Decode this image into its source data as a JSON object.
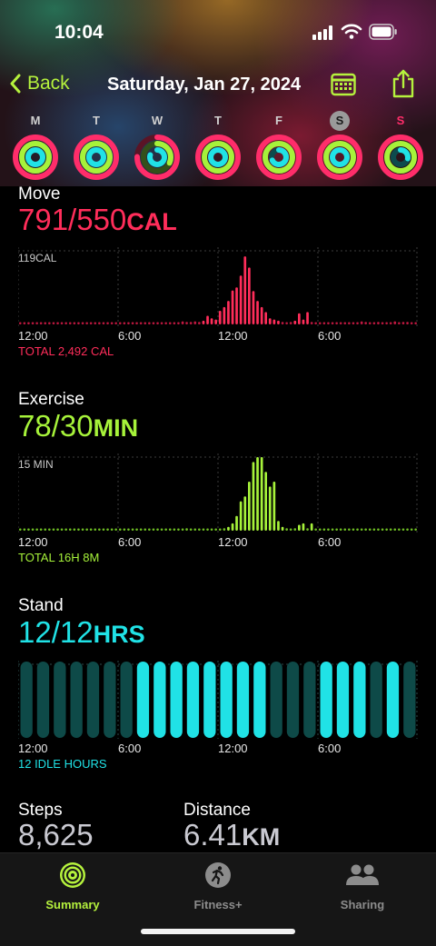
{
  "status": {
    "time": "10:04"
  },
  "nav": {
    "back_label": "Back",
    "title": "Saturday, Jan 27, 2024"
  },
  "week": [
    {
      "letter": "M"
    },
    {
      "letter": "T"
    },
    {
      "letter": "W"
    },
    {
      "letter": "T"
    },
    {
      "letter": "F"
    },
    {
      "letter": "S"
    },
    {
      "letter": "S"
    }
  ],
  "colors": {
    "move": "#ff2d5a",
    "exercise": "#a6f23a",
    "stand": "#20e2e6",
    "accent": "#b5f23d"
  },
  "move": {
    "title": "Move",
    "value": "791/550",
    "unit": "CAL",
    "max_label": "119CAL",
    "total": "TOTAL 2,492 CAL",
    "ticks": [
      "12:00",
      "6:00",
      "12:00",
      "6:00"
    ]
  },
  "exercise": {
    "title": "Exercise",
    "value": "78/30",
    "unit": "MIN",
    "max_label": "15 MIN",
    "total": "TOTAL 16H 8M",
    "ticks": [
      "12:00",
      "6:00",
      "12:00",
      "6:00"
    ]
  },
  "stand": {
    "title": "Stand",
    "value": "12/12",
    "unit": "HRS",
    "total": "12 IDLE HOURS",
    "ticks": [
      "12:00",
      "6:00",
      "12:00",
      "6:00"
    ]
  },
  "steps": {
    "label": "Steps",
    "value": "8,625"
  },
  "distance": {
    "label": "Distance",
    "value": "6.41",
    "unit": "KM"
  },
  "tabs": [
    {
      "label": "Summary",
      "icon": "activity-rings-icon"
    },
    {
      "label": "Fitness+",
      "icon": "fitness-runner-icon"
    },
    {
      "label": "Sharing",
      "icon": "people-icon"
    }
  ],
  "chart_data": [
    {
      "type": "bar",
      "title": "Move",
      "x": "minutes of day (2 bars per 15 min)",
      "ymax": 119,
      "values": [
        2,
        2,
        2,
        2,
        2,
        2,
        2,
        2,
        2,
        2,
        2,
        2,
        2,
        2,
        2,
        2,
        2,
        2,
        2,
        2,
        2,
        2,
        2,
        2,
        2,
        2,
        2,
        2,
        2,
        2,
        2,
        2,
        2,
        2,
        2,
        2,
        3,
        3,
        3,
        5,
        4,
        4,
        5,
        4,
        6,
        14,
        10,
        8,
        22,
        28,
        38,
        55,
        60,
        79,
        110,
        92,
        54,
        38,
        28,
        20,
        10,
        8,
        6,
        4,
        3,
        4,
        6,
        18,
        8,
        20,
        4,
        3,
        2,
        2,
        2,
        2,
        2,
        2,
        2,
        2,
        2,
        2,
        5,
        4,
        2,
        2,
        4,
        3,
        3,
        3,
        5,
        3,
        4,
        4,
        3,
        2
      ]
    },
    {
      "type": "bar",
      "title": "Exercise",
      "ymax": 15,
      "values": [
        0.3,
        0.3,
        0.3,
        0.3,
        0.3,
        0.3,
        0.3,
        0.3,
        0.3,
        0.3,
        0.3,
        0.3,
        0.3,
        0.3,
        0.3,
        0.3,
        0.3,
        0.3,
        0.3,
        0.3,
        0.3,
        0.3,
        0.3,
        0.3,
        0.3,
        0.3,
        0.3,
        0.3,
        0.3,
        0.3,
        0.3,
        0.3,
        0.3,
        0.3,
        0.3,
        0.3,
        0.3,
        0.3,
        0.3,
        0.3,
        0.5,
        0.3,
        0.3,
        0.3,
        0.3,
        0.3,
        0.3,
        0.3,
        0.3,
        0.5,
        0.8,
        1.5,
        3,
        6,
        7,
        10,
        14,
        15,
        15,
        12,
        9,
        10,
        2,
        0.8,
        0.5,
        0.3,
        0.5,
        1.2,
        1.5,
        0.5,
        1.5,
        0.3,
        0.3,
        0.3,
        0.3,
        0.3,
        0.3,
        0.3,
        0.3,
        0.3,
        0.3,
        0.3,
        0.3,
        0.3,
        0.3,
        0.3,
        0.3,
        0.3,
        0.3,
        0.3,
        0.3,
        0.3,
        0.3,
        0.3,
        0.3,
        0.3
      ]
    },
    {
      "type": "bar",
      "title": "Stand",
      "hours_active": [
        false,
        false,
        false,
        false,
        false,
        false,
        false,
        true,
        true,
        true,
        true,
        true,
        true,
        true,
        true,
        false,
        false,
        false,
        true,
        true,
        true,
        false,
        true,
        false
      ]
    }
  ]
}
